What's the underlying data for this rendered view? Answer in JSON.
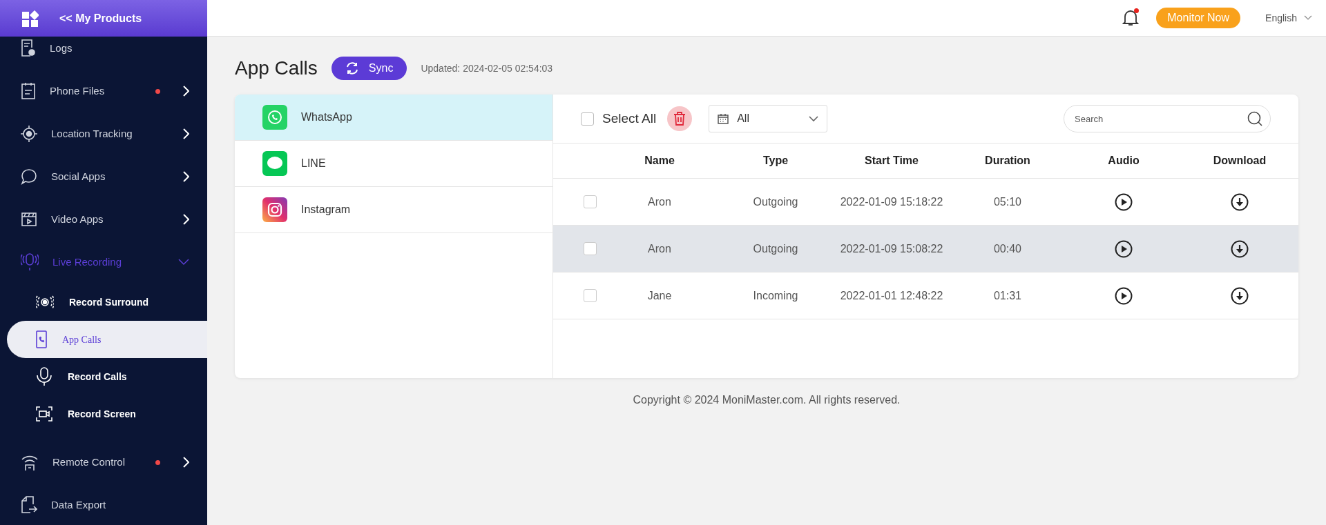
{
  "sidebar": {
    "header": "<< My Products",
    "items": [
      {
        "label": "Logs",
        "dot": false
      },
      {
        "label": "Phone Files",
        "dot": true,
        "expanded": false
      },
      {
        "label": "Location Tracking",
        "dot": false,
        "expanded": false
      },
      {
        "label": "Social Apps",
        "dot": false,
        "expanded": false
      },
      {
        "label": "Video Apps",
        "dot": false,
        "expanded": false
      },
      {
        "label": "Live Recording",
        "dot": false,
        "expanded": true,
        "children": [
          {
            "label": "Record Surround",
            "selected": false
          },
          {
            "label": "App Calls",
            "selected": true
          },
          {
            "label": "Record Calls",
            "selected": false
          },
          {
            "label": "Record Screen",
            "selected": false
          }
        ]
      },
      {
        "label": "Remote Control",
        "dot": true,
        "expanded": false
      },
      {
        "label": "Data Export",
        "dot": false
      }
    ]
  },
  "topbar": {
    "notification": true,
    "monitor_button": "Monitor Now",
    "language": "English"
  },
  "page": {
    "title": "App Calls",
    "sync_button": "Sync",
    "updated": "Updated: 2024-02-05 02:54:03"
  },
  "apps": [
    {
      "name": "WhatsApp",
      "selected": true
    },
    {
      "name": "LINE",
      "selected": false
    },
    {
      "name": "Instagram",
      "selected": false
    }
  ],
  "toolbar": {
    "select_all": {
      "label": "Select All",
      "checked": false
    },
    "filter": "All",
    "search": {
      "placeholder": "Search"
    }
  },
  "table": {
    "columns": [
      "Name",
      "Type",
      "Start Time",
      "Duration",
      "Audio",
      "Download"
    ],
    "rows": [
      {
        "checked": false,
        "highlighted": false,
        "name": "Aron",
        "type": "Outgoing",
        "start_time": "2022-01-09 15:18:22",
        "duration": "05:10"
      },
      {
        "checked": false,
        "highlighted": true,
        "name": "Aron",
        "type": "Outgoing",
        "start_time": "2022-01-09 15:08:22",
        "duration": "00:40"
      },
      {
        "checked": false,
        "highlighted": false,
        "name": "Jane",
        "type": "Incoming",
        "start_time": "2022-01-01 12:48:22",
        "duration": "01:31"
      }
    ]
  },
  "footer": "Copyright © 2024 MoniMaster.com. All rights reserved."
}
